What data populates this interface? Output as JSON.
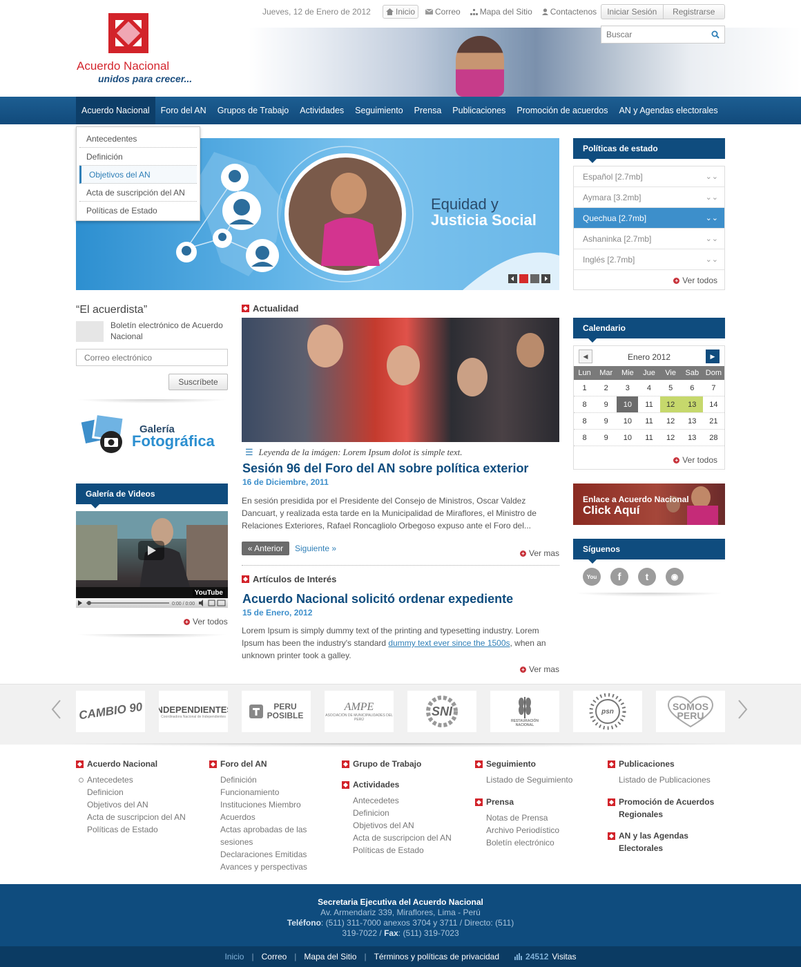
{
  "header": {
    "logo_name": "Acuerdo Nacional",
    "logo_tagline": "unidos para crecer...",
    "date": "Jueves, 12 de Enero de 2012",
    "links": [
      {
        "label": "Inicio",
        "icon": "home-icon"
      },
      {
        "label": "Correo",
        "icon": "mail-icon"
      },
      {
        "label": "Mapa del Sitio",
        "icon": "sitemap-icon"
      },
      {
        "label": "Contactenos",
        "icon": "user-icon"
      }
    ],
    "login_label": "Iniciar Sesión",
    "register_label": "Registrarse",
    "search_placeholder": "Buscar"
  },
  "nav": {
    "items": [
      "Acuerdo Nacional",
      "Foro del AN",
      "Grupos de Trabajo",
      "Actividades",
      "Seguimiento",
      "Prensa",
      "Publicaciones",
      "Promoción de acuerdos",
      "AN y Agendas electorales"
    ],
    "active_index": 0,
    "dropdown": [
      "Antecedentes",
      "Definición",
      "Objetivos del AN",
      "Acta de suscripción del AN",
      "Políticas de Estado"
    ],
    "dropdown_selected": 2
  },
  "banner": {
    "line1": "Equidad y",
    "line2": "Justicia Social",
    "slides": 3,
    "active_slide": 1
  },
  "policies": {
    "title": "Políticas de estado",
    "items": [
      "Español [2.7mb]",
      "Aymara [3.2mb]",
      "Quechua [2.7mb]",
      "Ashaninka [2.7mb]",
      "Inglés [2.7mb]"
    ],
    "selected": 2,
    "more": "Ver todos"
  },
  "calendar": {
    "title": "Calendario",
    "month": "Enero 2012",
    "weekdays": [
      "Lun",
      "Mar",
      "Mie",
      "Jue",
      "Vie",
      "Sab",
      "Dom"
    ],
    "weeks": [
      [
        "1",
        "2",
        "3",
        "4",
        "5",
        "6",
        "7"
      ],
      [
        "8",
        "9",
        "10",
        "11",
        "12",
        "13",
        "14"
      ],
      [
        "8",
        "9",
        "10",
        "11",
        "12",
        "13",
        "21"
      ],
      [
        "8",
        "9",
        "10",
        "11",
        "12",
        "13",
        "28"
      ]
    ],
    "today_day": "10",
    "highlighted_days": [
      "12",
      "13"
    ],
    "more": "Ver todos"
  },
  "enlace": {
    "line1": "Enlace a Acuerdo Nacional",
    "line2": "Click Aquí"
  },
  "siguenos": {
    "title": "Síguenos",
    "icons": [
      "youtube-icon",
      "facebook-icon",
      "twitter-icon",
      "rss-icon"
    ],
    "glyphs": [
      "You",
      "f",
      "t",
      "◉"
    ]
  },
  "acuerdista": {
    "title": "“El acuerdista”",
    "text": "Boletín electrónico de Acuerdo Nacional",
    "email_placeholder": "Correo electrónico",
    "button": "Suscríbete"
  },
  "galeria_foto": {
    "line1": "Galería",
    "line2": "Fotográfica"
  },
  "videos": {
    "title": "Galería de Videos",
    "time": "0:00 / 0:00",
    "more": "Ver todos",
    "brand": "YouTube"
  },
  "actualidad": {
    "heading": "Actualidad",
    "caption": "Leyenda de la imágen: Lorem Ipsum dolot is simple text.",
    "title": "Sesión 96 del Foro del AN sobre política exterior",
    "date": "16 de Diciembre, 2011",
    "body": "En sesión presidida por el Presidente del Consejo de Ministros, Oscar Valdez Dancuart, y realizada esta tarde en la Municipalidad de Miraflores, el Ministro de Relaciones Exteriores, Rafael Roncagliolo Orbegoso expuso ante el Foro del...",
    "prev": "« Anterior",
    "next": "Siguiente »",
    "more": "Ver mas"
  },
  "articulos": {
    "heading": "Artículos de Interés",
    "title": "Acuerdo Nacional solicitó ordenar expediente",
    "date": "15 de Enero, 2012",
    "body_1": "Lorem Ipsum is simply dummy text of the printing and typesetting industry. Lorem Ipsum has been the industry's standard ",
    "body_link": "dummy text ever since the 1500s",
    "body_2": ", when an unknown printer took a galley.",
    "more": "Ver mas"
  },
  "partners": [
    "CAMBIO 90",
    "INDEPENDIENTES",
    "PERU POSIBLE",
    "AMPE",
    "SNI",
    "RESTAURACIÓN NACIONAL",
    "psn",
    "SOMOS PERU"
  ],
  "partners_sub": [
    "",
    "Coordinadora Nacional de Independientes",
    "",
    "ASOCIACIÓN DE MUNICIPALIDADES DEL PERÚ",
    "",
    "",
    "",
    ""
  ],
  "footer_links": {
    "col1": {
      "title": "Acuerdo Nacional",
      "items": [
        "Antecedetes",
        "Definicion",
        "Objetivos del AN",
        "Acta de suscripcion del AN",
        "Políticas de Estado"
      ]
    },
    "col2": {
      "title": "Foro del AN",
      "items": [
        "Definición",
        "Funcionamiento",
        "Instituciones Miembro",
        "Acuerdos",
        "Actas aprobadas de las sesiones",
        "Declaraciones Emitidas",
        "Avances y perspectivas"
      ]
    },
    "col3a": {
      "title": "Grupo de Trabajo"
    },
    "col3b": {
      "title": "Actividades",
      "items": [
        "Antecedetes",
        "Definicion",
        "Objetivos del AN",
        "Acta de suscripcion del AN",
        "Políticas de Estado"
      ]
    },
    "col4a": {
      "title": "Seguimiento",
      "items": [
        "Listado de Seguimiento"
      ]
    },
    "col4b": {
      "title": "Prensa",
      "items": [
        "Notas de Prensa",
        "Archivo Periodístico",
        "Boletín electrónico"
      ]
    },
    "col5a": {
      "title": "Publicaciones",
      "items": [
        "Listado de Publicaciones"
      ]
    },
    "col5b": {
      "title": "Promoción de Acuerdos Regionales"
    },
    "col5c": {
      "title": "AN y las Agendas Electorales"
    }
  },
  "footer": {
    "org": "Secretaria Ejecutiva del Acuerdo Nacional",
    "address": "Av. Armendariz 339, Miraflores, Lima - Perú",
    "phone_label": "Teléfono",
    "phone": ": (511) 311-7000 anexos 3704 y 3711 / Directo: (511)",
    "phone2": "319-7022 / ",
    "fax_label": "Fax",
    "fax": ": (511) 319-7023",
    "links": [
      "Inicio",
      "Correo",
      "Mapa del Sitio",
      "Términos y políticas de privacidad"
    ],
    "visits_count": "24512",
    "visits_label": "Visitas"
  },
  "colors": {
    "brand_blue": "#0f4c7e",
    "accent_red": "#d2232a",
    "link_blue": "#2f7fb7",
    "highlight_green": "#c6d86c"
  }
}
